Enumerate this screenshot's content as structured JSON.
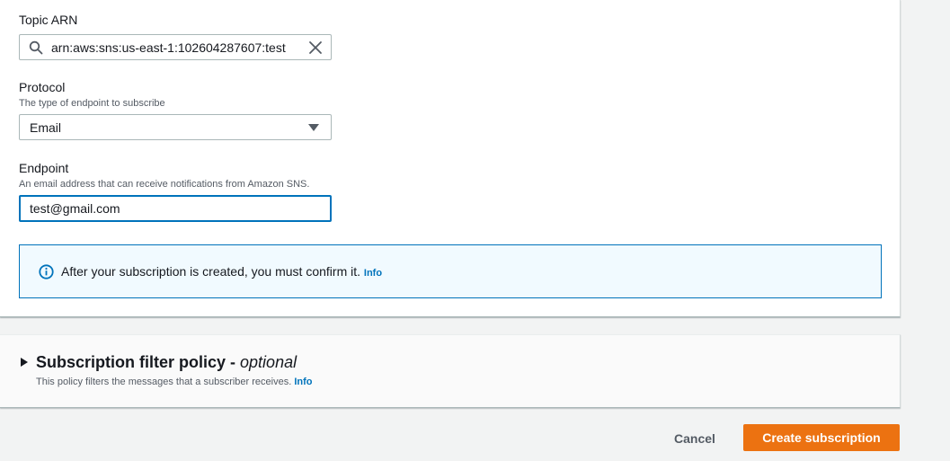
{
  "form": {
    "topic_arn": {
      "label": "Topic ARN",
      "value": "arn:aws:sns:us-east-1:102604287607:test",
      "search_icon": "search-icon",
      "clear_icon": "close-icon"
    },
    "protocol": {
      "label": "Protocol",
      "description": "The type of endpoint to subscribe",
      "selected": "Email",
      "caret_icon": "caret-down-icon"
    },
    "endpoint": {
      "label": "Endpoint",
      "description": "An email address that can receive notifications from Amazon SNS.",
      "value": "test@gmail.com"
    },
    "alert": {
      "icon": "info-icon",
      "text": "After your subscription is created, you must confirm it.",
      "info_link": "Info"
    }
  },
  "filter_policy": {
    "title": "Subscription filter policy - ",
    "title_optional": "optional",
    "description": "This policy filters the messages that a subscriber receives.",
    "info_link": "Info",
    "expand_icon": "caret-right-icon"
  },
  "footer": {
    "cancel_label": "Cancel",
    "create_label": "Create subscription"
  },
  "colors": {
    "accent": "#0073bb",
    "primary_button": "#ec7211",
    "alert_bg": "#f1faff",
    "page_bg": "#f2f3f3"
  }
}
